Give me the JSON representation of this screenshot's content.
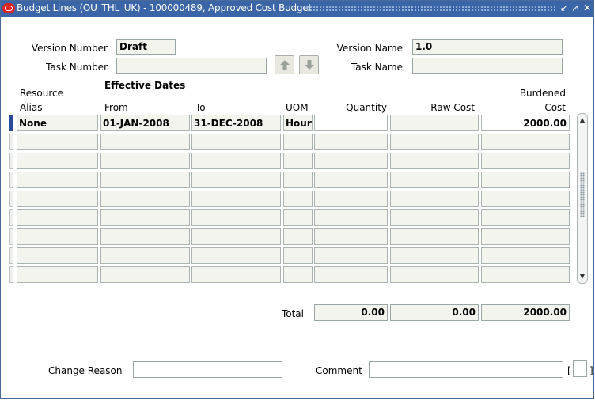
{
  "window": {
    "title": "Budget Lines (OU_THL_UK) - 100000489, Approved Cost Budget",
    "controls": [
      "↙",
      "↗",
      "✕"
    ]
  },
  "header": {
    "version_number_label": "Version Number",
    "version_number_value": "Draft",
    "version_name_label": "Version Name",
    "version_name_value": "1.0",
    "task_number_label": "Task Number",
    "task_number_value": "",
    "task_name_label": "Task Name",
    "task_name_value": ""
  },
  "grid": {
    "effective_dates_label": "Effective Dates",
    "columns": {
      "resource_alias_line1": "Resource",
      "resource_alias_line2": "Alias",
      "from": "From",
      "to": "To",
      "uom": "UOM",
      "quantity": "Quantity",
      "raw_cost": "Raw Cost",
      "burdened_line1": "Burdened",
      "burdened_line2": "Cost"
    },
    "rows": [
      {
        "alias": "None",
        "from": "01-JAN-2008",
        "to": "31-DEC-2008",
        "uom": "Hours",
        "quantity": "",
        "raw_cost": "",
        "burdened_cost": "2000.00"
      },
      {
        "alias": "",
        "from": "",
        "to": "",
        "uom": "",
        "quantity": "",
        "raw_cost": "",
        "burdened_cost": ""
      },
      {
        "alias": "",
        "from": "",
        "to": "",
        "uom": "",
        "quantity": "",
        "raw_cost": "",
        "burdened_cost": ""
      },
      {
        "alias": "",
        "from": "",
        "to": "",
        "uom": "",
        "quantity": "",
        "raw_cost": "",
        "burdened_cost": ""
      },
      {
        "alias": "",
        "from": "",
        "to": "",
        "uom": "",
        "quantity": "",
        "raw_cost": "",
        "burdened_cost": ""
      },
      {
        "alias": "",
        "from": "",
        "to": "",
        "uom": "",
        "quantity": "",
        "raw_cost": "",
        "burdened_cost": ""
      },
      {
        "alias": "",
        "from": "",
        "to": "",
        "uom": "",
        "quantity": "",
        "raw_cost": "",
        "burdened_cost": ""
      },
      {
        "alias": "",
        "from": "",
        "to": "",
        "uom": "",
        "quantity": "",
        "raw_cost": "",
        "burdened_cost": ""
      },
      {
        "alias": "",
        "from": "",
        "to": "",
        "uom": "",
        "quantity": "",
        "raw_cost": "",
        "burdened_cost": ""
      }
    ]
  },
  "totals": {
    "label": "Total",
    "quantity": "0.00",
    "raw_cost": "0.00",
    "burdened_cost": "2000.00"
  },
  "footer": {
    "change_reason_label": "Change  Reason",
    "change_reason_value": "",
    "comment_label": "Comment",
    "comment_value": "",
    "bracket_open": "[",
    "bracket_close": "]"
  }
}
